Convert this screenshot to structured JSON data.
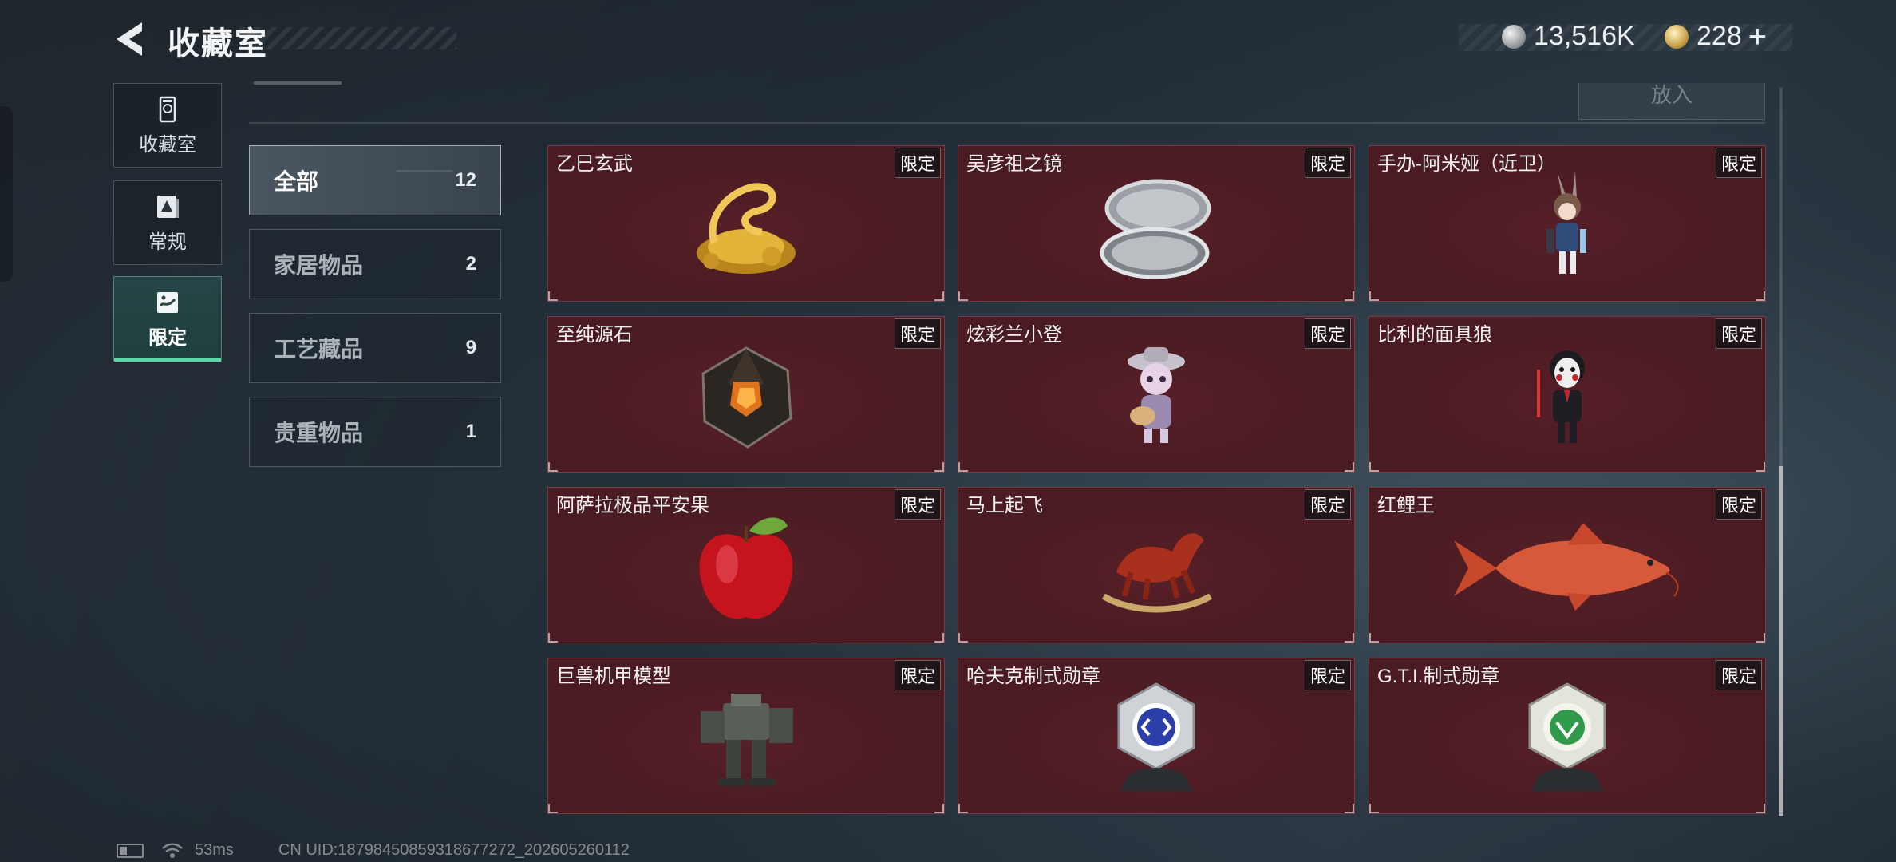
{
  "header": {
    "title": "收藏室",
    "currencies": [
      {
        "icon": "silver-coin-icon",
        "amount": "13,516K"
      },
      {
        "icon": "gold-token-icon",
        "amount": "228",
        "plus": "+"
      }
    ]
  },
  "side_tabs": [
    {
      "icon": "collection-room-icon",
      "label": "收藏室",
      "active": false
    },
    {
      "icon": "regular-items-icon",
      "label": "常规",
      "active": false
    },
    {
      "icon": "limited-items-icon",
      "label": "限定",
      "active": true
    }
  ],
  "place_button": "放入",
  "categories": [
    {
      "name": "全部",
      "count": "12",
      "active": true
    },
    {
      "name": "家居物品",
      "count": "2",
      "active": false
    },
    {
      "name": "工艺藏品",
      "count": "9",
      "active": false
    },
    {
      "name": "贵重物品",
      "count": "1",
      "active": false
    }
  ],
  "items": [
    {
      "name": "乙巳玄武",
      "badge": "限定",
      "icon": "golden-snake-turtle-icon"
    },
    {
      "name": "吴彦祖之镜",
      "badge": "限定",
      "icon": "compact-mirror-icon"
    },
    {
      "name": "手办-阿米娅（近卫）",
      "badge": "限定",
      "icon": "amiya-figure-icon"
    },
    {
      "name": "至纯源石",
      "badge": "限定",
      "icon": "originium-crystal-icon"
    },
    {
      "name": "炫彩兰小登",
      "badge": "限定",
      "icon": "mariachi-figure-icon"
    },
    {
      "name": "比利的面具狼",
      "badge": "限定",
      "icon": "billy-puppet-icon"
    },
    {
      "name": "阿萨拉极品平安果",
      "badge": "限定",
      "icon": "red-apple-icon"
    },
    {
      "name": "马上起飞",
      "badge": "限定",
      "icon": "rocking-horse-icon"
    },
    {
      "name": "红鲤王",
      "badge": "限定",
      "icon": "red-carp-icon"
    },
    {
      "name": "巨兽机甲模型",
      "badge": "限定",
      "icon": "mech-model-icon"
    },
    {
      "name": "哈夫克制式勋章",
      "badge": "限定",
      "icon": "haavk-medal-icon"
    },
    {
      "name": "G.T.I.制式勋章",
      "badge": "限定",
      "icon": "gti-medal-icon"
    }
  ],
  "status_bar": {
    "ping": "53ms",
    "uid": "CN UID:18798450859318677272_202605260112"
  },
  "colors": {
    "card_bg": "#4a1b22",
    "active_tab_accent": "#5fd6a4"
  }
}
